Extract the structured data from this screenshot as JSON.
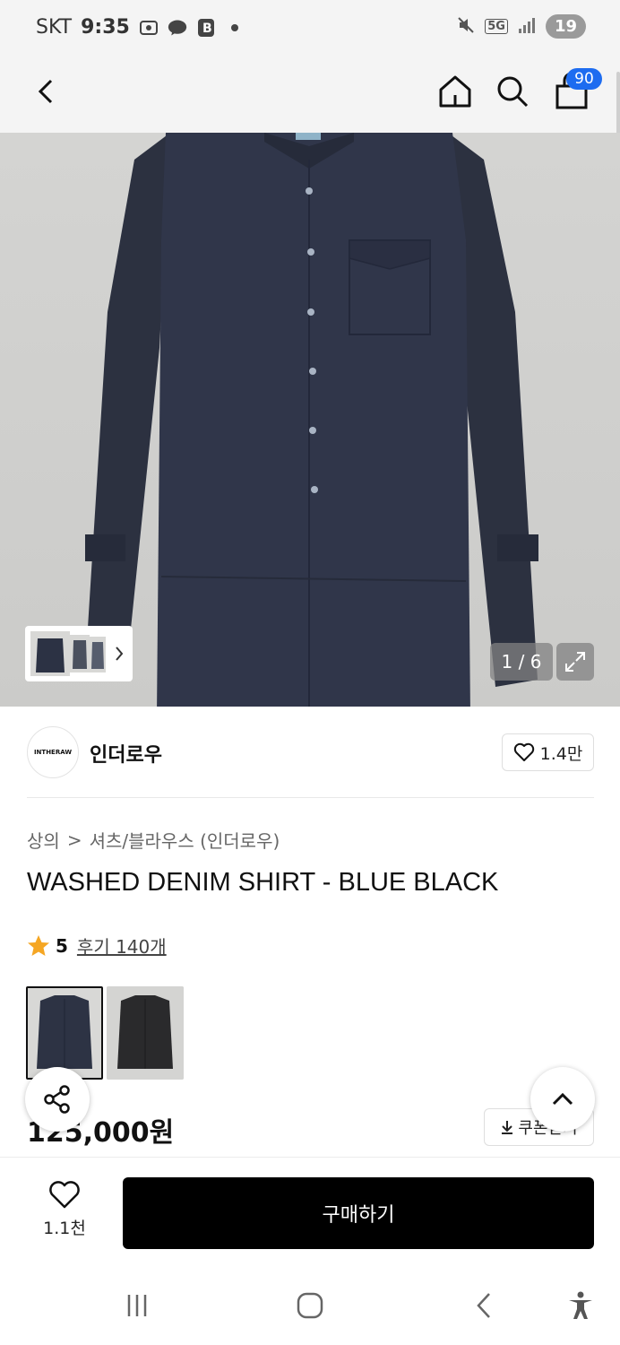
{
  "status_bar": {
    "carrier": "SKT",
    "time": "9:35",
    "network": "5G",
    "battery": "19"
  },
  "header": {
    "cart_count": "90"
  },
  "gallery": {
    "counter": "1 / 6"
  },
  "brand": {
    "logo_text": "INTHERAW",
    "name": "인더로우",
    "like_count": "1.4만"
  },
  "breadcrumb": {
    "category": "상의",
    "separator": ">",
    "subcategory": "셔츠/블라우스 (인더로우)"
  },
  "product": {
    "title": "WASHED DENIM SHIRT - BLUE BLACK",
    "rating": "5",
    "reviews": "후기 140개",
    "price": "125,000원",
    "coupon_label": "쿠폰받기"
  },
  "variants": [
    {
      "name": "navy",
      "color": "#2d3344"
    },
    {
      "name": "black",
      "color": "#2a2a2c"
    }
  ],
  "bottom_bar": {
    "wish_count": "1.1천",
    "buy_label": "구매하기"
  },
  "colors": {
    "accent": "#1d6cf0",
    "star": "#f5a623",
    "primary": "#000000"
  }
}
